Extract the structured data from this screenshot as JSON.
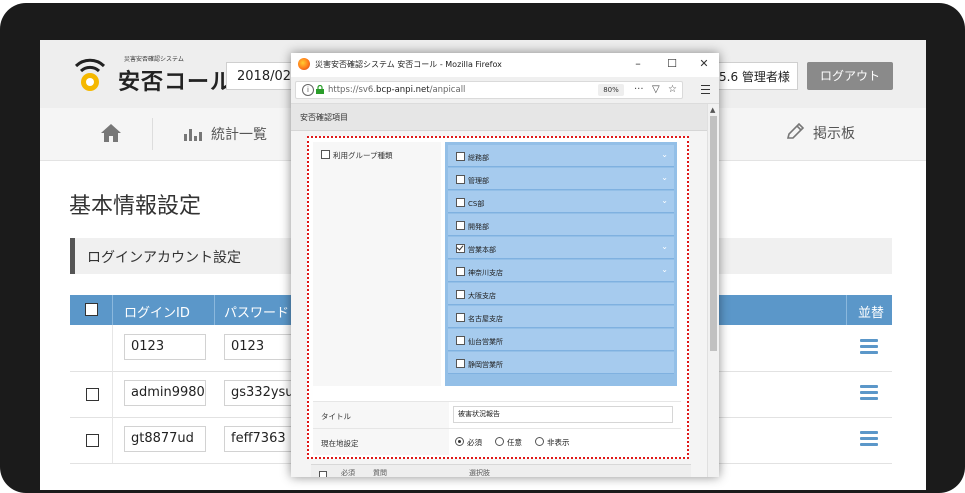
{
  "app": {
    "logo_small": "災害安否確認システム",
    "logo_main": "安否コール",
    "date": "2018/02/2",
    "version_user": "5.6 管理者様",
    "logout_label": "ログアウト"
  },
  "nav": {
    "stats_label": "統計一覧",
    "board_label": "掲示板"
  },
  "page": {
    "title": "基本情報設定",
    "section_title": "ログインアカウント設定"
  },
  "table": {
    "headers": [
      "ログインID",
      "パスワード",
      "並替"
    ],
    "rows": [
      {
        "id": "0123",
        "password": "0123",
        "has_checkbox": false
      },
      {
        "id": "admin9980",
        "password": "gs332ysu",
        "has_checkbox": true
      },
      {
        "id": "gt8877ud",
        "password": "feff7363",
        "has_checkbox": true
      }
    ]
  },
  "popup": {
    "window_title": "災害安否確認システム 安否コール - Mozilla Firefox",
    "url_prefix": "https://sv6.",
    "url_domain": "bcp-anpi.net",
    "url_path": "/anpicall",
    "zoom": "80%",
    "content_header": "安否確認項目",
    "group_label": "利用グループ種類",
    "groups": [
      {
        "name": "総務部",
        "checked": false,
        "expandable": true
      },
      {
        "name": "管理部",
        "checked": false,
        "expandable": true
      },
      {
        "name": "CS部",
        "checked": false,
        "expandable": true
      },
      {
        "name": "開発部",
        "checked": false,
        "expandable": false
      },
      {
        "name": "営業本部",
        "checked": true,
        "expandable": true
      },
      {
        "name": "神奈川支店",
        "checked": false,
        "expandable": true
      },
      {
        "name": "大阪支店",
        "checked": false,
        "expandable": false
      },
      {
        "name": "名古屋支店",
        "checked": false,
        "expandable": false
      },
      {
        "name": "仙台営業所",
        "checked": false,
        "expandable": false
      },
      {
        "name": "静岡営業所",
        "checked": false,
        "expandable": false
      }
    ],
    "title_label": "タイトル",
    "title_value": "被害状況報告",
    "location_label": "現在地設定",
    "location_options": [
      "必須",
      "任意",
      "非表示"
    ],
    "location_selected": 0,
    "bottom_cols": [
      "必須",
      "質問",
      "選択肢"
    ]
  },
  "colors": {
    "accent": "#5b97c9",
    "group_bg": "#a6cbee",
    "highlight_border": "#e01818"
  }
}
